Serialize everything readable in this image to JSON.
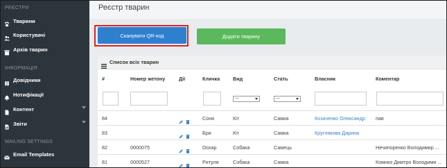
{
  "sidebar": {
    "sections": [
      {
        "title": "РЕЄСТРИ",
        "items": [
          {
            "label": "Тварини",
            "icon": "paw-icon",
            "has_submenu": false
          },
          {
            "label": "Користувачі",
            "icon": "users-icon",
            "has_submenu": false
          },
          {
            "label": "Архів тварин",
            "icon": "archive-icon",
            "has_submenu": false
          }
        ]
      },
      {
        "title": "ІНФОРМАЦІЯ",
        "items": [
          {
            "label": "Довідники",
            "icon": "book-icon",
            "has_submenu": false
          },
          {
            "label": "Нотифікації",
            "icon": "bell-icon",
            "has_submenu": false
          },
          {
            "label": "Контент",
            "icon": "document-icon",
            "has_submenu": true
          },
          {
            "label": "Звіти",
            "icon": "report-icon",
            "has_submenu": true
          }
        ]
      },
      {
        "title": "MAILING SETTINGS",
        "items": [
          {
            "label": "Email Templates",
            "icon": "envelope-icon",
            "has_submenu": false
          }
        ]
      }
    ]
  },
  "page": {
    "title": "Реєстр тварин"
  },
  "toolbar": {
    "scan_label": "Сканувати QR-код",
    "add_label": "Додати тварину"
  },
  "panel": {
    "title": "Список всіх тварин"
  },
  "table": {
    "headers": [
      "#",
      "Номер жетону",
      "Дії",
      "Кличка",
      "Вид",
      "Стать",
      "Власник",
      "Коментар"
    ],
    "filter_select_value": "---",
    "rows": [
      {
        "id": "84",
        "token": "",
        "name": "Соня",
        "species": "Кіт",
        "sex": "Самка",
        "owner": "Козаченко Олександр",
        "comment": "пав"
      },
      {
        "id": "83",
        "token": "",
        "name": "Бри",
        "species": "Кіт",
        "sex": "Самка",
        "owner": "Круглякова Дарина",
        "comment": ""
      },
      {
        "id": "82",
        "token": "0000075",
        "name": "Оскар",
        "species": "Собака",
        "sex": "Самець",
        "owner": "",
        "comment": "Нечипоренко Володимир ..."
      },
      {
        "id": "81",
        "token": "0000527",
        "name": "Ритуля",
        "species": "Собака",
        "sex": "Самка",
        "owner": "",
        "comment": "Комнко Дмитро Володими ..."
      }
    ]
  },
  "colors": {
    "sidebar_bg": "#2d353c",
    "primary": "#2f7fcf",
    "success": "#5cb85c",
    "highlight": "#e02020",
    "link": "#3a7fd1"
  }
}
